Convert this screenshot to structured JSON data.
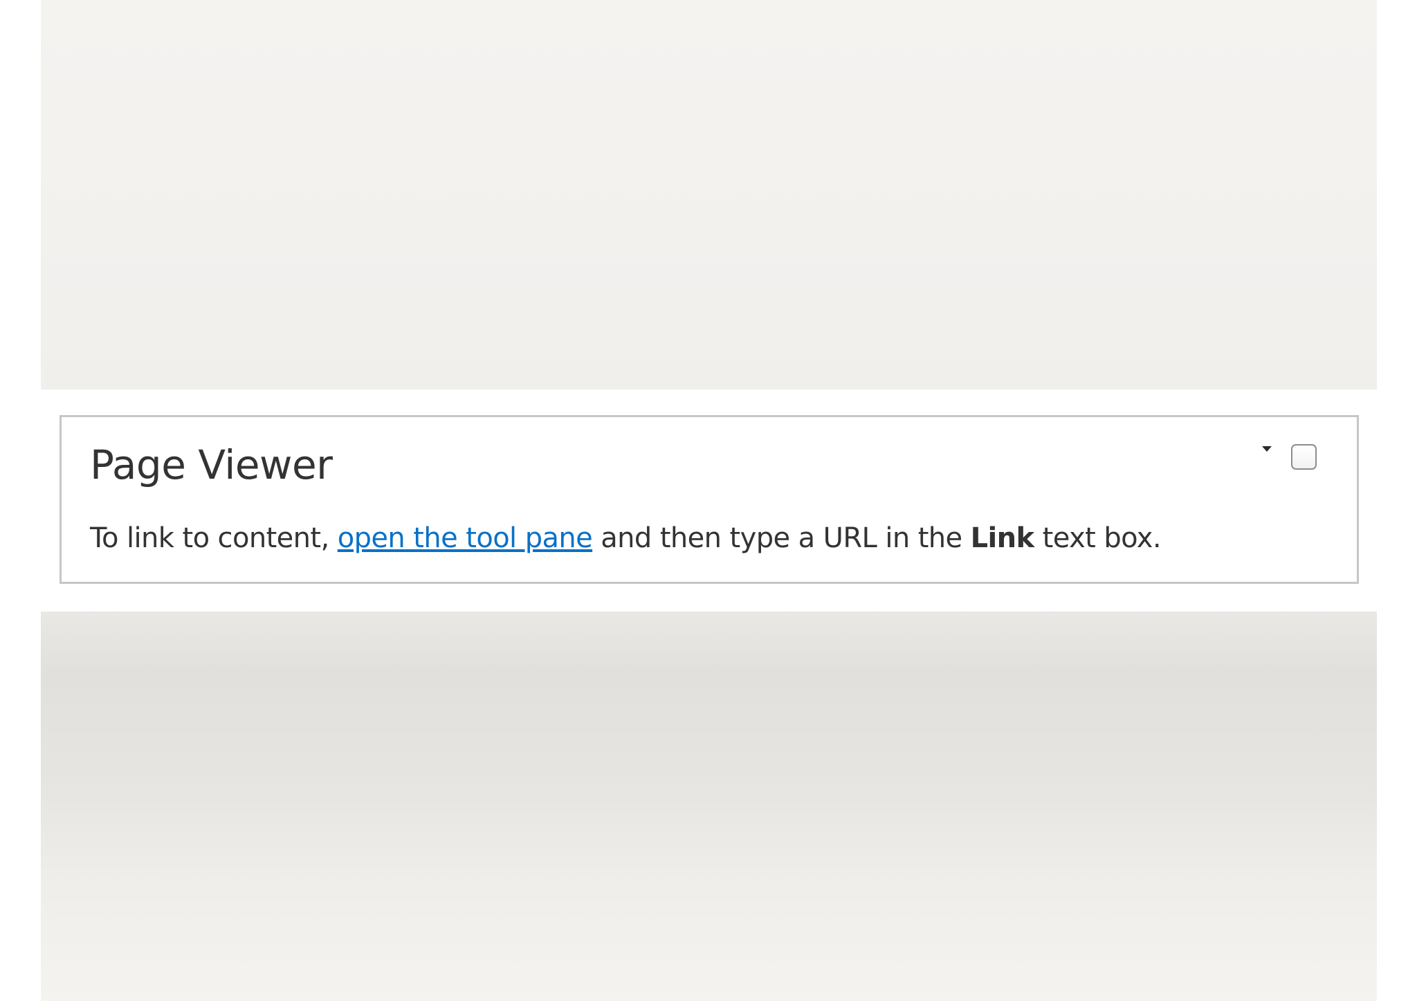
{
  "webpart": {
    "title": "Page Viewer",
    "message": {
      "before": "To link to content, ",
      "link_text": "open the tool pane",
      "middle": " and then type a URL in the ",
      "bold_text": "Link",
      "after": " text box."
    },
    "menu_icon": "caret-down-icon",
    "selection_checked": false
  },
  "colors": {
    "link": "#0a71c8",
    "text": "#333333",
    "border": "#c6c6c6"
  }
}
